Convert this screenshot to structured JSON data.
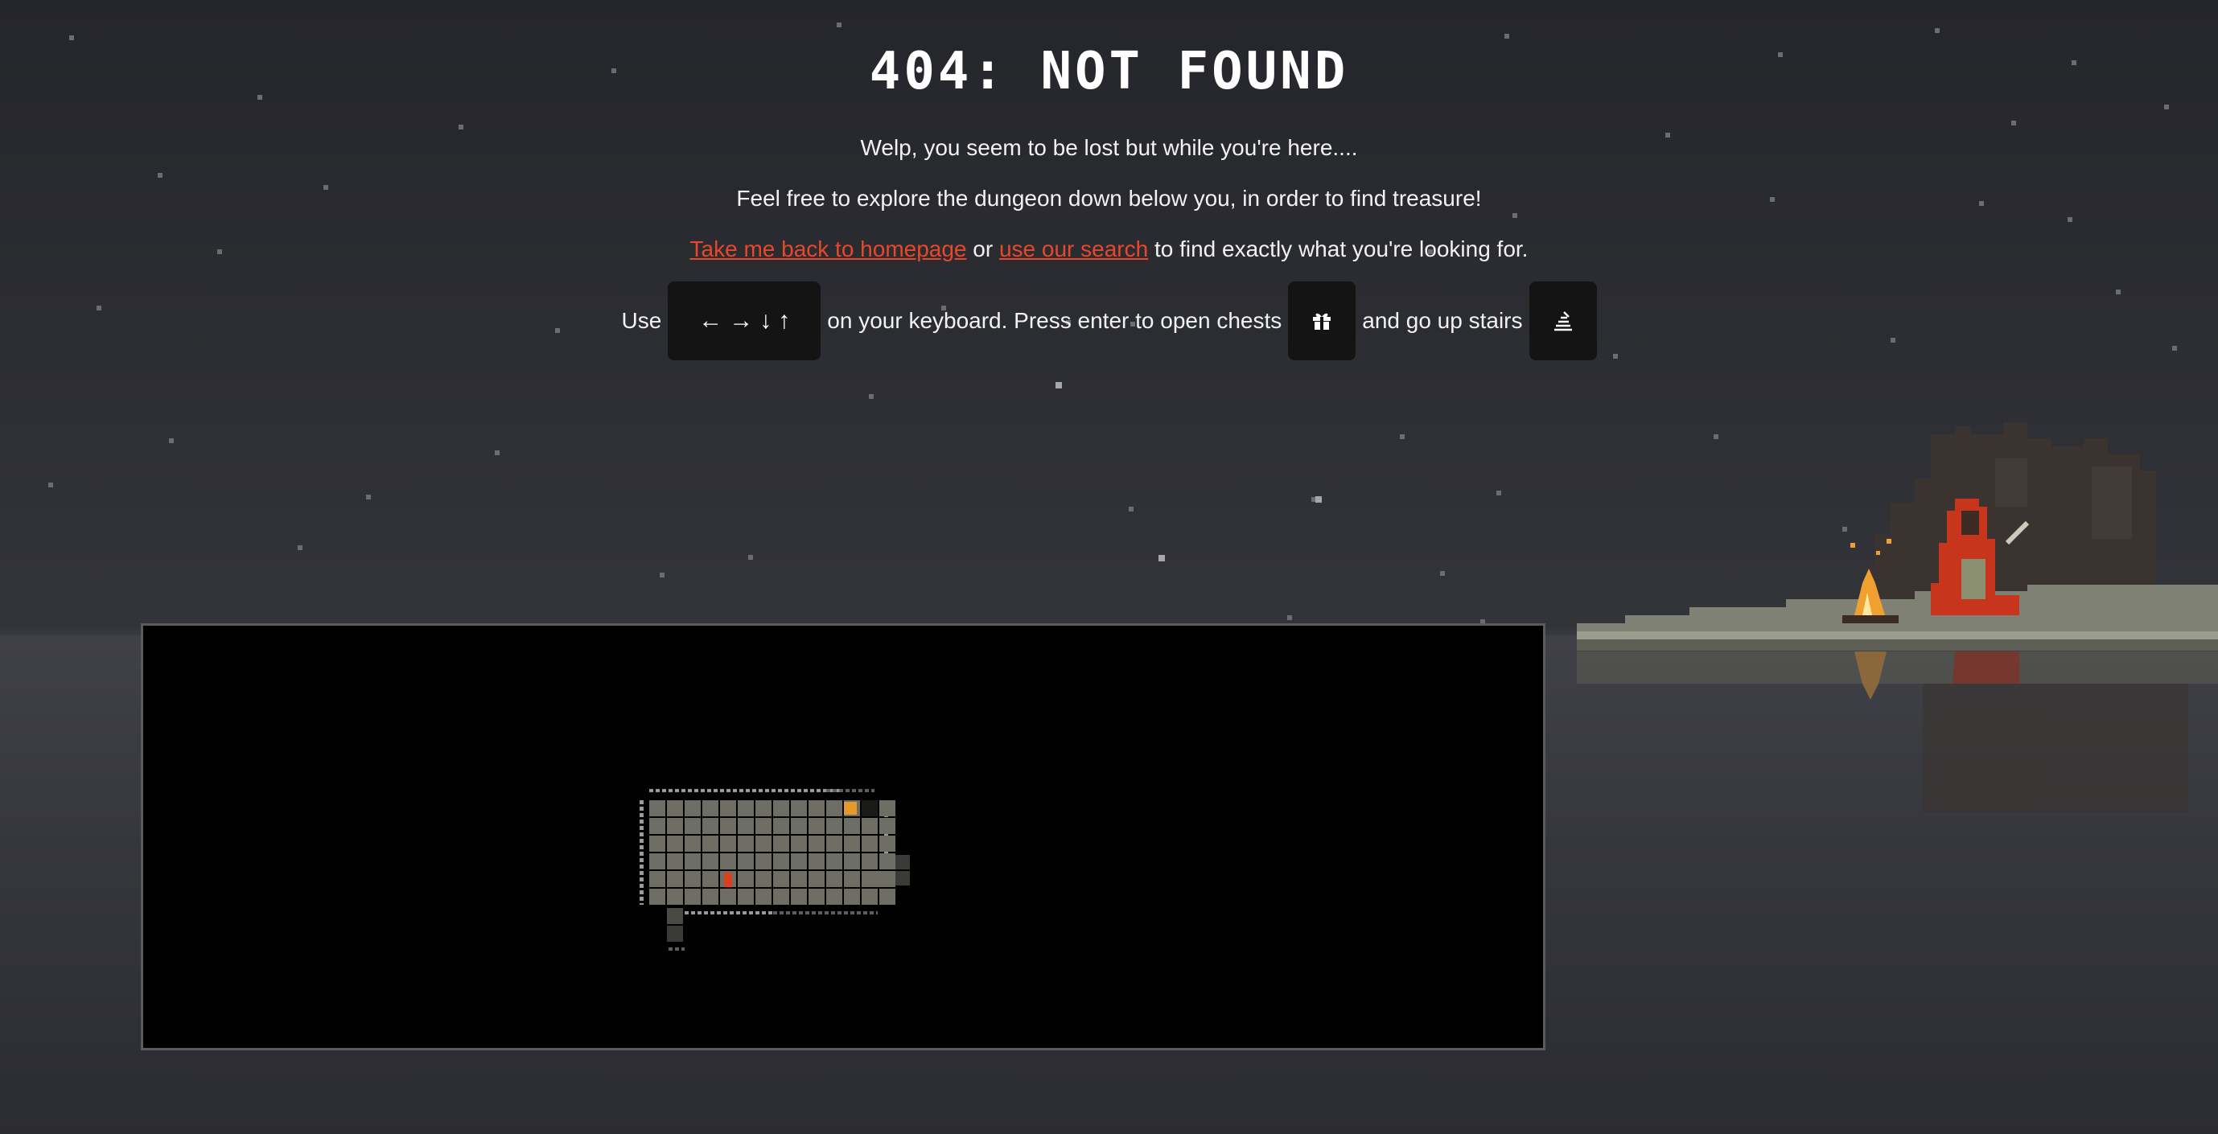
{
  "page": {
    "title": "404: NOT FOUND",
    "line1": "Welp, you seem to be lost but while you're here....",
    "line2": "Feel free to explore the dungeon down below you, in order to find treasure!",
    "homepage_link": "Take me back to homepage",
    "or_text": "or",
    "search_link": "use our search",
    "find_text": "to find exactly what you're looking for."
  },
  "instructions": {
    "use": "Use",
    "arrows": [
      "←",
      "→",
      "↓",
      "↑"
    ],
    "keyboard_text": "on your keyboard. Press enter to open chests",
    "stairs_text": "and go up stairs",
    "chest_icon": "gift-icon",
    "stairs_icon": "stairs-icon"
  },
  "colors": {
    "accent": "#e8472c",
    "background": "#2b2c31",
    "game_bg": "#000000",
    "floor": "#6e6e64"
  }
}
